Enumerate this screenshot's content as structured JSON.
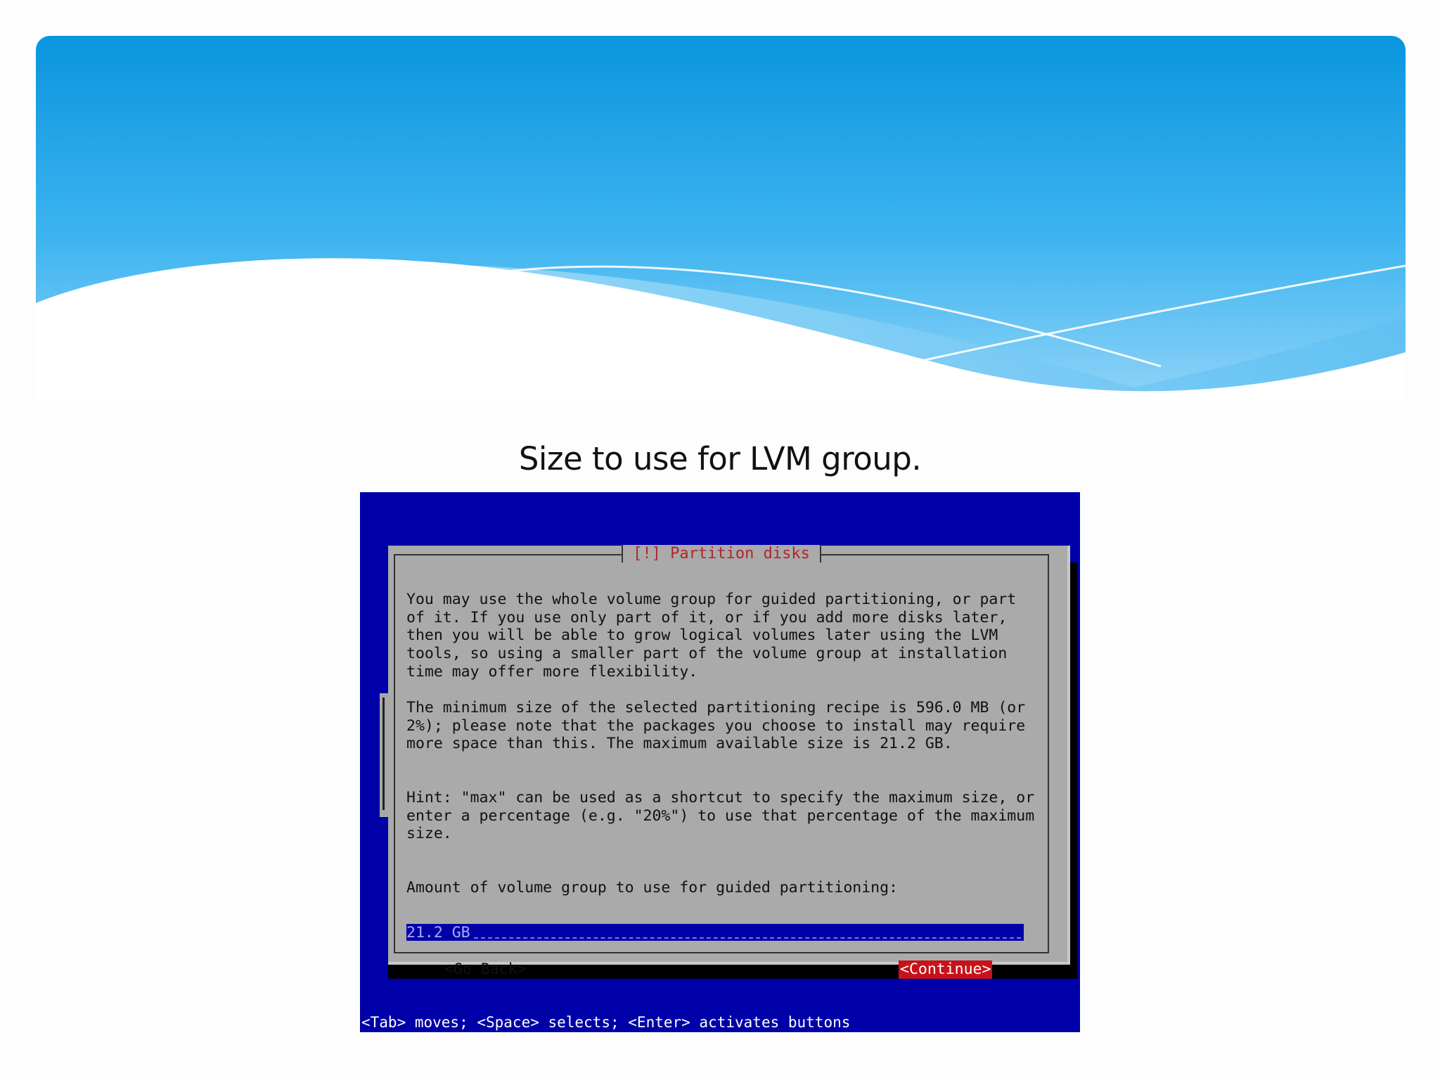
{
  "slide": {
    "title": "Size to use for LVM group."
  },
  "installer": {
    "dialog_title": "[!] Partition disks",
    "paragraph_1": "You may use the whole volume group for guided partitioning, or part\nof it. If you use only part of it, or if you add more disks later,\nthen you will be able to grow logical volumes later using the LVM\ntools, so using a smaller part of the volume group at installation\ntime may offer more flexibility.",
    "paragraph_2": "The minimum size of the selected partitioning recipe is 596.0 MB (or\n2%); please note that the packages you choose to install may require\nmore space than this. The maximum available size is 21.2 GB.",
    "paragraph_3": "Hint: \"max\" can be used as a shortcut to specify the maximum size, or\nenter a percentage (e.g. \"20%\") to use that percentage of the maximum\nsize.",
    "prompt": "Amount of volume group to use for guided partitioning:",
    "amount_value": "21.2 GB",
    "go_back_label": "<Go Back>",
    "continue_label": "<Continue>",
    "help_bar": "<Tab> moves; <Space> selects; <Enter> activates buttons"
  },
  "colors": {
    "installer_background": "#0000a8",
    "dialog_background": "#aaaaaa",
    "dialog_title_red": "#b0252e",
    "selected_button": "#c8121a",
    "banner_blue": "#0a95de"
  }
}
